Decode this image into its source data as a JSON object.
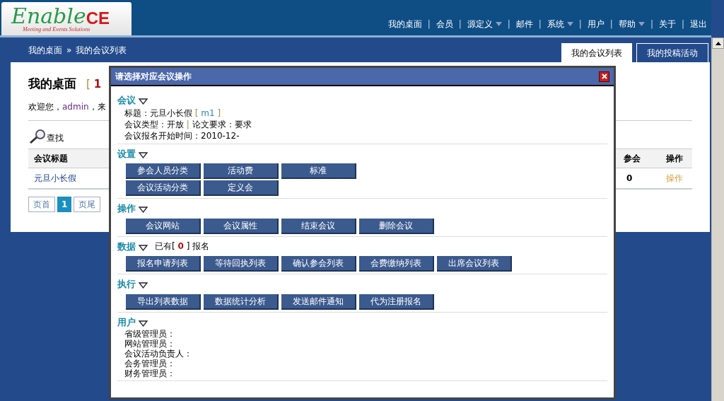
{
  "header": {
    "logo": {
      "name": "Enable",
      "accent": "CE",
      "tagline": "Meeting and Events Solutions"
    },
    "nav": [
      {
        "label": "我的桌面",
        "dropdown": false
      },
      {
        "label": "会员",
        "dropdown": false
      },
      {
        "label": "源定义",
        "dropdown": true
      },
      {
        "label": "邮件",
        "dropdown": false
      },
      {
        "label": "系统",
        "dropdown": true
      },
      {
        "label": "用户",
        "dropdown": false
      },
      {
        "label": "帮助",
        "dropdown": true
      },
      {
        "label": "关于",
        "dropdown": false
      },
      {
        "label": "退出",
        "dropdown": false
      }
    ],
    "nav_separator": "|"
  },
  "breadcrumb": {
    "items": [
      "我的桌面",
      "我的会议列表"
    ],
    "separator": "»"
  },
  "tabs": [
    {
      "label": "我的会议列表",
      "selected": true
    },
    {
      "label": "我的投稿活动",
      "selected": false
    }
  ],
  "panel": {
    "title": "我的桌面",
    "title_note": [
      {
        "text": "[ ",
        "kind": "bracket"
      },
      {
        "text": "1",
        "kind": "count"
      }
    ],
    "welcome": [
      {
        "text": "欢迎您，",
        "kind": "text"
      },
      {
        "text": "admin",
        "kind": "user"
      },
      {
        "text": "，来",
        "kind": "text"
      }
    ],
    "search": "查找",
    "table": {
      "columns": [
        "会议标题",
        "参会",
        "操作"
      ],
      "rows": [
        {
          "title": "元旦小长假",
          "count": "0",
          "action": "操作"
        }
      ]
    },
    "pagination": [
      {
        "label": "页首",
        "selected": false
      },
      {
        "label": "1",
        "selected": true
      },
      {
        "label": "页尾",
        "selected": false
      }
    ]
  },
  "dialog": {
    "title": "请选择对应会议操作",
    "sections": [
      {
        "kind": "info",
        "title": "会议",
        "lines": [
          [
            {
              "text": "标题：元旦小长假 ",
              "kind": "text"
            },
            {
              "text": "[ ",
              "kind": "bracket"
            },
            {
              "text": "m1",
              "kind": "link"
            },
            {
              "text": " ]",
              "kind": "bracket"
            }
          ],
          [
            {
              "text": "会议类型：开放 ",
              "kind": "text"
            },
            {
              "text": " | ",
              "kind": "bracket"
            },
            {
              "text": " 论文要求：要求",
              "kind": "text"
            }
          ],
          [
            {
              "text": "会议报名开始时间：2010-12-",
              "kind": "text"
            }
          ]
        ]
      },
      {
        "kind": "buttons",
        "title": "设置",
        "rows": [
          [
            "参会人员分类",
            "活动费",
            "标准"
          ],
          [
            "会议活动分类",
            "定义会"
          ]
        ]
      },
      {
        "kind": "buttons",
        "title": "操作",
        "rows": [
          [
            "会议网站",
            "会议属性",
            "结束会议",
            "删除会议"
          ]
        ]
      },
      {
        "kind": "buttons",
        "title": "数据",
        "note": [
          {
            "text": "已有[ ",
            "kind": "text"
          },
          {
            "text": "0",
            "kind": "count"
          },
          {
            "text": " ] 报名",
            "kind": "text"
          }
        ],
        "rows": [
          [
            "报名申请列表",
            "等待回执列表",
            "确认参会列表",
            "会费缴纳列表",
            "出席会议列表"
          ]
        ]
      },
      {
        "kind": "buttons",
        "title": "执行",
        "rows": [
          [
            "导出列表数据",
            "数据统计分析",
            "发送邮件通知",
            "代为注册报名"
          ]
        ]
      },
      {
        "kind": "people",
        "title": "用户",
        "lines": [
          "省级管理员：",
          "网站管理员：",
          "会议活动负责人：",
          "会务管理员：",
          "财务管理员："
        ]
      }
    ]
  }
}
